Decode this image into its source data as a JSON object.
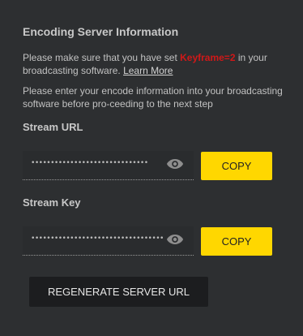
{
  "section": {
    "title": "Encoding Server Information"
  },
  "info": {
    "keyframe_prefix": "Please make sure that you have set ",
    "keyframe_value": "Keyframe=2",
    "keyframe_suffix": " in your broadcasting software. ",
    "learn_more": "Learn More",
    "encode_text": "Please enter your encode information into your broadcasting software before pro-ceeding to the next step"
  },
  "stream_url": {
    "label": "Stream URL",
    "masked_value": "••••••••••••••••••••••••••••••",
    "copy_label": "COPY"
  },
  "stream_key": {
    "label": "Stream Key",
    "masked_value": "••••••••••••••••••••••••••••••••••",
    "copy_label": "COPY"
  },
  "regenerate_label": "REGENERATE SERVER URL",
  "colors": {
    "background": "#2d2f31",
    "accent_yellow": "#ffd700",
    "keyframe_red": "#d01818",
    "dark_button": "#1c1d1f"
  },
  "icons": {
    "reveal": "eye-icon"
  }
}
